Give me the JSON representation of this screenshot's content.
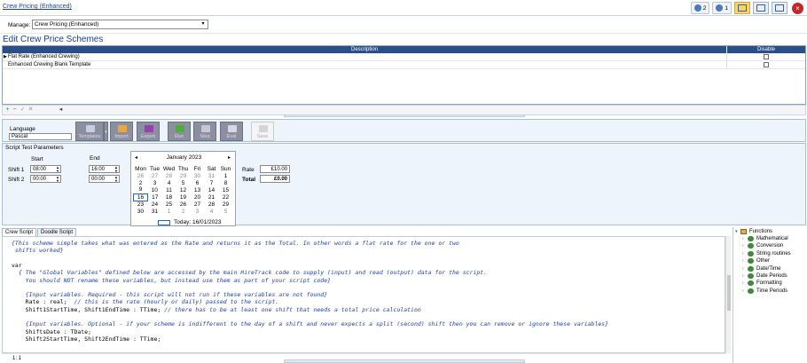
{
  "window": {
    "title_link": "Crew Pricing (Enhanced)",
    "badge_a": "2",
    "badge_b": "1"
  },
  "manage": {
    "label": "Manage:",
    "value": "Crew Pricing (Enhanced)"
  },
  "section_title": "Edit Crew Price Schemes",
  "grid": {
    "columns": [
      "Description",
      "Disable"
    ],
    "rows": [
      {
        "description": "Flat Rate (Enhanced Crewing)",
        "disable": false
      },
      {
        "description": "Enhanced Crewing Blank Template",
        "disable": false
      }
    ]
  },
  "navigator": {
    "add": "+",
    "remove": "−",
    "confirm": "✓",
    "cancel": "✕",
    "prev": "◂"
  },
  "script_toolbar": {
    "language_label": "Language",
    "language_value": "Pascal",
    "buttons": [
      "Templates",
      "Import",
      "Export",
      "Run",
      "Step",
      "Eval",
      "Save"
    ]
  },
  "test_params": {
    "title": "Script Test Parameters",
    "start_label": "Start",
    "end_label": "End",
    "shifts": [
      {
        "label": "Shift 1",
        "start": "08:00",
        "end": "16:00"
      },
      {
        "label": "Shift 2",
        "start": "00:00",
        "end": "00:00"
      }
    ],
    "rate_label": "Rate",
    "rate_value": "£10.00",
    "total_label": "Total",
    "total_value": "£0.00"
  },
  "calendar": {
    "month": "January 2023",
    "prev": "◂",
    "next": "▸",
    "weekdays": [
      "Mon",
      "Tue",
      "Wed",
      "Thu",
      "Fri",
      "Sat",
      "Sun"
    ],
    "weeks": [
      [
        {
          "d": "26",
          "dim": true
        },
        {
          "d": "27",
          "dim": true
        },
        {
          "d": "28",
          "dim": true
        },
        {
          "d": "29",
          "dim": true
        },
        {
          "d": "30",
          "dim": true
        },
        {
          "d": "31",
          "dim": true
        },
        {
          "d": "1"
        }
      ],
      [
        {
          "d": "2"
        },
        {
          "d": "3"
        },
        {
          "d": "4"
        },
        {
          "d": "5"
        },
        {
          "d": "6"
        },
        {
          "d": "7"
        },
        {
          "d": "8"
        }
      ],
      [
        {
          "d": "9"
        },
        {
          "d": "10"
        },
        {
          "d": "11"
        },
        {
          "d": "12"
        },
        {
          "d": "13"
        },
        {
          "d": "14"
        },
        {
          "d": "15"
        }
      ],
      [
        {
          "d": "16",
          "today": true
        },
        {
          "d": "17"
        },
        {
          "d": "18"
        },
        {
          "d": "19"
        },
        {
          "d": "20"
        },
        {
          "d": "21"
        },
        {
          "d": "22"
        }
      ],
      [
        {
          "d": "23"
        },
        {
          "d": "24"
        },
        {
          "d": "25"
        },
        {
          "d": "26"
        },
        {
          "d": "27"
        },
        {
          "d": "28"
        },
        {
          "d": "29"
        }
      ],
      [
        {
          "d": "30"
        },
        {
          "d": "31"
        },
        {
          "d": "1",
          "dim": true
        },
        {
          "d": "2",
          "dim": true
        },
        {
          "d": "3",
          "dim": true
        },
        {
          "d": "4",
          "dim": true
        },
        {
          "d": "5",
          "dim": true
        }
      ]
    ],
    "today_text": "Today: 16/01/2023"
  },
  "tabs": [
    "Crew Script",
    "Doodle Script"
  ],
  "editor_lines": [
    {
      "t": "{This scheme simple takes what was entered as the Rate and returns it as the Total. In other words a flat rate for the one or two",
      "c": "cmt"
    },
    {
      "t": " shifts worked}",
      "c": "cmt"
    },
    {
      "t": "",
      "c": "kw"
    },
    {
      "t": "var",
      "c": "kw"
    },
    {
      "t": "  { The \"Global Variables\" defined below are accessed by the main HireTrack code to supply (input) and read (output) data for the script.",
      "c": "cmt"
    },
    {
      "t": "    You should NOT rename these variables, but instead use them as part of your script code}",
      "c": "cmt"
    },
    {
      "t": "",
      "c": "kw"
    },
    {
      "t": "    {Input variables. Required - this script will not run if these variables are not found}",
      "c": "cmt"
    },
    {
      "t": "    Rate : real;  // this is the rate (hourly or daily) passed to the script.",
      "c": "mix1"
    },
    {
      "t": "    Shift1StartTime, Shift1EndTime : TTime; // there has to be at least one shift that needs a total price calculation",
      "c": "mix2"
    },
    {
      "t": "",
      "c": "kw"
    },
    {
      "t": "    {Input variables. Optional - if your scheme is indifferent to the day of a shift and never expects a split (second) shift then you can remove or ignore these variables}",
      "c": "cmt"
    },
    {
      "t": "    ShiftsDate : TDate;",
      "c": "kw"
    },
    {
      "t": "    Shift2StartTime, Shift2EndTime : TTime;",
      "c": "kw"
    }
  ],
  "status_pos": "1: 1",
  "tree": {
    "root": "Functions",
    "items": [
      "Mathematical",
      "Conversion",
      "String routines",
      "Other",
      "Date/Time",
      "Date Periods",
      "Formatting",
      "Time Periods"
    ]
  }
}
